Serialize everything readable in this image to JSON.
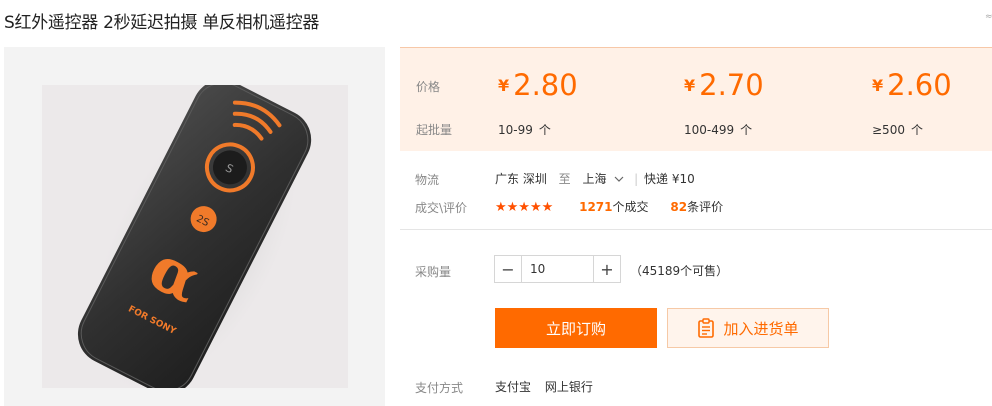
{
  "product": {
    "title": "S红外遥控器 2秒延迟拍摄 单反相机遥控器",
    "corner_mark": "≈",
    "remote_text": {
      "button_s": "S",
      "button_2s": "2S",
      "logo": "α",
      "brand": "FOR SONY"
    }
  },
  "pricing": {
    "price_label": "价格",
    "batch_label": "起批量",
    "currency": "¥",
    "tiers": [
      {
        "price": "2.80",
        "range": "10-99",
        "unit": "个"
      },
      {
        "price": "2.70",
        "range": "100-499",
        "unit": "个"
      },
      {
        "price": "2.60",
        "range": "≥500",
        "unit": "个"
      }
    ]
  },
  "logistics": {
    "label": "物流",
    "from": "广东 深圳",
    "to_word": "至",
    "to": "上海",
    "method": "快递 ¥10"
  },
  "deals": {
    "label": "成交\\评价",
    "stars": "★★★★★",
    "deal_count": "1271",
    "deal_suffix": "个成交",
    "review_count": "82",
    "review_suffix": "条评价"
  },
  "purchase": {
    "qty_label": "采购量",
    "minus": "−",
    "plus": "+",
    "qty_value": "10",
    "stock_text": "（45189个可售）",
    "buy_label": "立即订购",
    "cart_label": "加入进货单"
  },
  "payment": {
    "label": "支付方式",
    "methods": [
      "支付宝",
      "网上银行"
    ]
  },
  "colors": {
    "accent": "#ff6a00",
    "price_bg": "#fff1e7"
  }
}
